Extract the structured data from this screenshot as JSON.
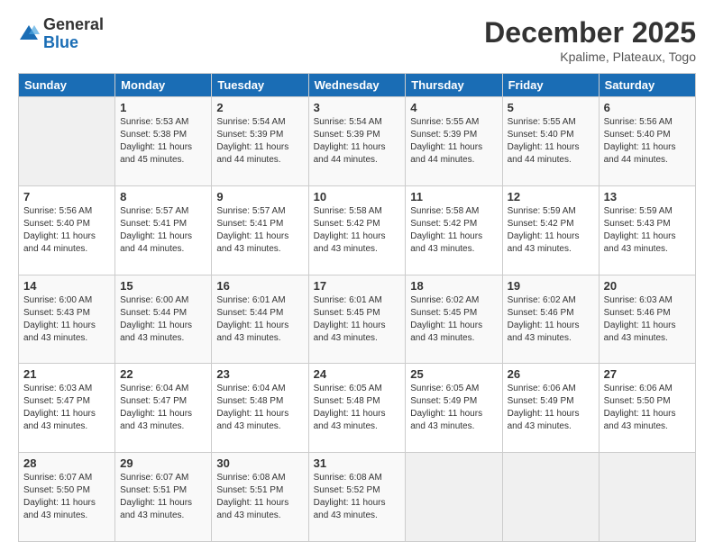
{
  "header": {
    "logo_general": "General",
    "logo_blue": "Blue",
    "month_title": "December 2025",
    "subtitle": "Kpalime, Plateaux, Togo"
  },
  "weekdays": [
    "Sunday",
    "Monday",
    "Tuesday",
    "Wednesday",
    "Thursday",
    "Friday",
    "Saturday"
  ],
  "weeks": [
    [
      {
        "day": "",
        "info": ""
      },
      {
        "day": "1",
        "info": "Sunrise: 5:53 AM\nSunset: 5:38 PM\nDaylight: 11 hours\nand 45 minutes."
      },
      {
        "day": "2",
        "info": "Sunrise: 5:54 AM\nSunset: 5:39 PM\nDaylight: 11 hours\nand 44 minutes."
      },
      {
        "day": "3",
        "info": "Sunrise: 5:54 AM\nSunset: 5:39 PM\nDaylight: 11 hours\nand 44 minutes."
      },
      {
        "day": "4",
        "info": "Sunrise: 5:55 AM\nSunset: 5:39 PM\nDaylight: 11 hours\nand 44 minutes."
      },
      {
        "day": "5",
        "info": "Sunrise: 5:55 AM\nSunset: 5:40 PM\nDaylight: 11 hours\nand 44 minutes."
      },
      {
        "day": "6",
        "info": "Sunrise: 5:56 AM\nSunset: 5:40 PM\nDaylight: 11 hours\nand 44 minutes."
      }
    ],
    [
      {
        "day": "7",
        "info": "Sunrise: 5:56 AM\nSunset: 5:40 PM\nDaylight: 11 hours\nand 44 minutes."
      },
      {
        "day": "8",
        "info": "Sunrise: 5:57 AM\nSunset: 5:41 PM\nDaylight: 11 hours\nand 44 minutes."
      },
      {
        "day": "9",
        "info": "Sunrise: 5:57 AM\nSunset: 5:41 PM\nDaylight: 11 hours\nand 43 minutes."
      },
      {
        "day": "10",
        "info": "Sunrise: 5:58 AM\nSunset: 5:42 PM\nDaylight: 11 hours\nand 43 minutes."
      },
      {
        "day": "11",
        "info": "Sunrise: 5:58 AM\nSunset: 5:42 PM\nDaylight: 11 hours\nand 43 minutes."
      },
      {
        "day": "12",
        "info": "Sunrise: 5:59 AM\nSunset: 5:42 PM\nDaylight: 11 hours\nand 43 minutes."
      },
      {
        "day": "13",
        "info": "Sunrise: 5:59 AM\nSunset: 5:43 PM\nDaylight: 11 hours\nand 43 minutes."
      }
    ],
    [
      {
        "day": "14",
        "info": "Sunrise: 6:00 AM\nSunset: 5:43 PM\nDaylight: 11 hours\nand 43 minutes."
      },
      {
        "day": "15",
        "info": "Sunrise: 6:00 AM\nSunset: 5:44 PM\nDaylight: 11 hours\nand 43 minutes."
      },
      {
        "day": "16",
        "info": "Sunrise: 6:01 AM\nSunset: 5:44 PM\nDaylight: 11 hours\nand 43 minutes."
      },
      {
        "day": "17",
        "info": "Sunrise: 6:01 AM\nSunset: 5:45 PM\nDaylight: 11 hours\nand 43 minutes."
      },
      {
        "day": "18",
        "info": "Sunrise: 6:02 AM\nSunset: 5:45 PM\nDaylight: 11 hours\nand 43 minutes."
      },
      {
        "day": "19",
        "info": "Sunrise: 6:02 AM\nSunset: 5:46 PM\nDaylight: 11 hours\nand 43 minutes."
      },
      {
        "day": "20",
        "info": "Sunrise: 6:03 AM\nSunset: 5:46 PM\nDaylight: 11 hours\nand 43 minutes."
      }
    ],
    [
      {
        "day": "21",
        "info": "Sunrise: 6:03 AM\nSunset: 5:47 PM\nDaylight: 11 hours\nand 43 minutes."
      },
      {
        "day": "22",
        "info": "Sunrise: 6:04 AM\nSunset: 5:47 PM\nDaylight: 11 hours\nand 43 minutes."
      },
      {
        "day": "23",
        "info": "Sunrise: 6:04 AM\nSunset: 5:48 PM\nDaylight: 11 hours\nand 43 minutes."
      },
      {
        "day": "24",
        "info": "Sunrise: 6:05 AM\nSunset: 5:48 PM\nDaylight: 11 hours\nand 43 minutes."
      },
      {
        "day": "25",
        "info": "Sunrise: 6:05 AM\nSunset: 5:49 PM\nDaylight: 11 hours\nand 43 minutes."
      },
      {
        "day": "26",
        "info": "Sunrise: 6:06 AM\nSunset: 5:49 PM\nDaylight: 11 hours\nand 43 minutes."
      },
      {
        "day": "27",
        "info": "Sunrise: 6:06 AM\nSunset: 5:50 PM\nDaylight: 11 hours\nand 43 minutes."
      }
    ],
    [
      {
        "day": "28",
        "info": "Sunrise: 6:07 AM\nSunset: 5:50 PM\nDaylight: 11 hours\nand 43 minutes."
      },
      {
        "day": "29",
        "info": "Sunrise: 6:07 AM\nSunset: 5:51 PM\nDaylight: 11 hours\nand 43 minutes."
      },
      {
        "day": "30",
        "info": "Sunrise: 6:08 AM\nSunset: 5:51 PM\nDaylight: 11 hours\nand 43 minutes."
      },
      {
        "day": "31",
        "info": "Sunrise: 6:08 AM\nSunset: 5:52 PM\nDaylight: 11 hours\nand 43 minutes."
      },
      {
        "day": "",
        "info": ""
      },
      {
        "day": "",
        "info": ""
      },
      {
        "day": "",
        "info": ""
      }
    ]
  ]
}
